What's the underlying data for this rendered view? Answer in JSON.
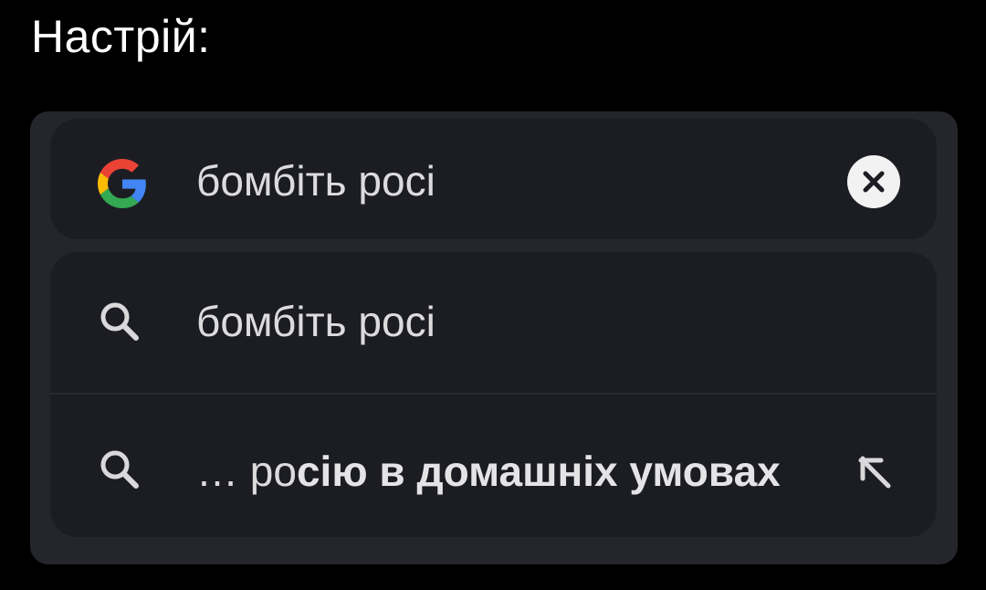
{
  "header": {
    "title": "Настрій:"
  },
  "search_bar": {
    "logo_icon": "google-g-icon",
    "query": "бомбіть росі",
    "clear_icon": "close-icon"
  },
  "suggestions": [
    {
      "icon": "search-icon",
      "prefix": "бомбіть росі",
      "completion": ""
    },
    {
      "icon": "search-icon",
      "prefix": "… ро",
      "completion": "сію в домашніх умовах",
      "action_icon": "fill-query-arrow-icon"
    }
  ],
  "colors": {
    "background": "#000000",
    "panel": "#25262c",
    "field": "#1c1d22",
    "text": "#dcdcdf",
    "google_blue": "#4285F4",
    "google_red": "#EA4335",
    "google_yellow": "#FBBC05",
    "google_green": "#34A853"
  }
}
